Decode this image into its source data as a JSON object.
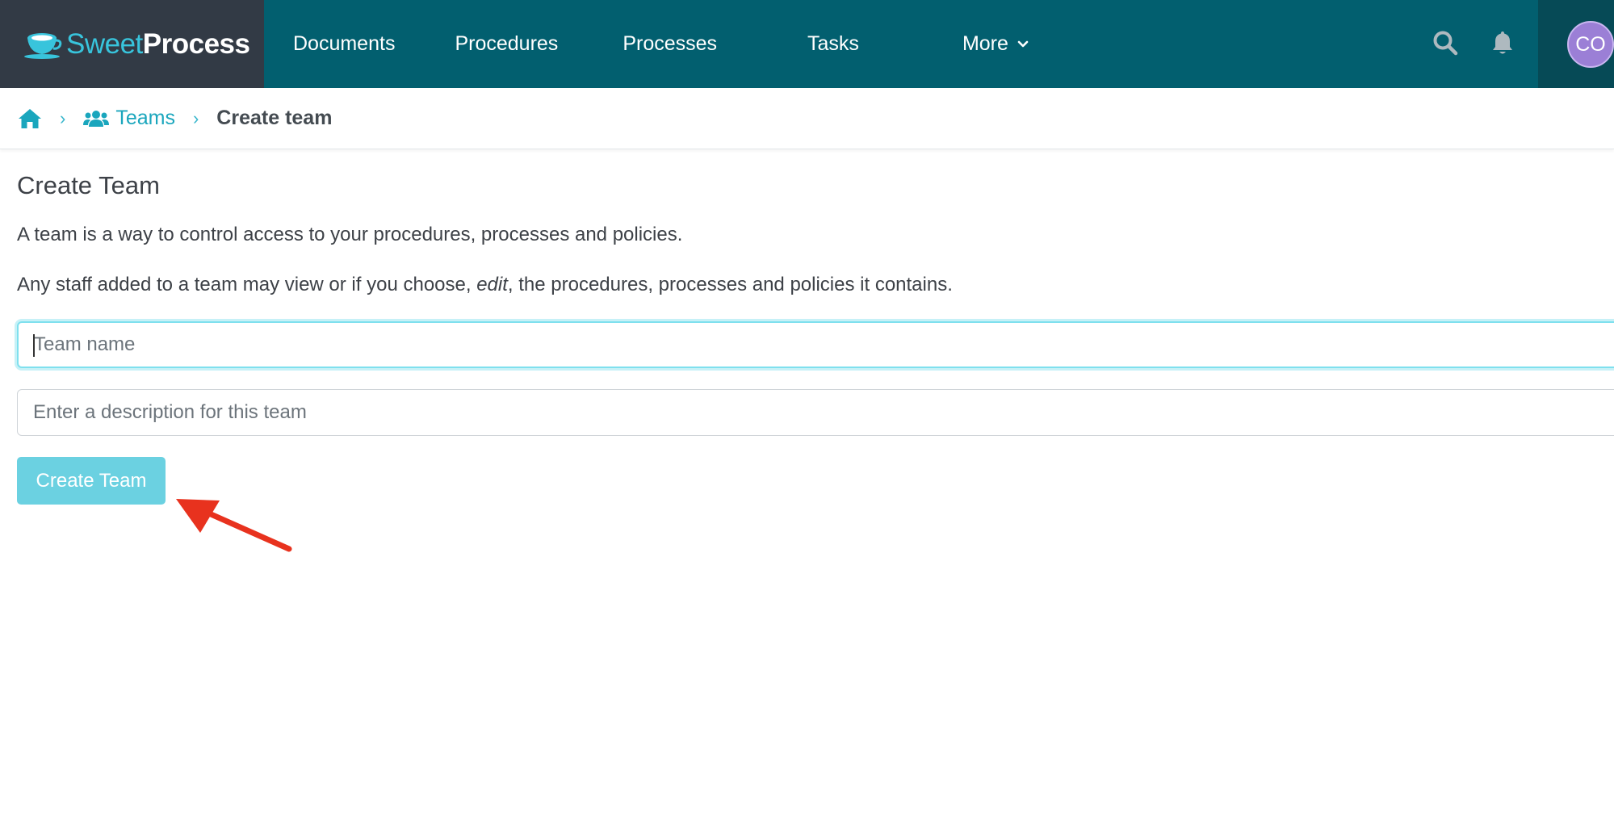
{
  "app": {
    "brand_sweet": "Sweet",
    "brand_process": "Process"
  },
  "nav": {
    "items": [
      {
        "label": "Documents"
      },
      {
        "label": "Procedures"
      },
      {
        "label": "Processes"
      },
      {
        "label": "Tasks"
      },
      {
        "label": "More"
      }
    ],
    "icons": [
      "search-icon",
      "bell-icon",
      "chevron-down-icon"
    ],
    "avatar_initials": "CO"
  },
  "breadcrumb": {
    "teams": "Teams",
    "current": "Create team"
  },
  "main": {
    "title": "Create Team",
    "para1": "A team is a way to control access to your procedures, processes and policies.",
    "para2_before": "Any staff added to a team may view or if you choose, ",
    "para2_em": "edit",
    "para2_after": ", the procedures, processes and policies it contains.",
    "team_name_placeholder": "Team name",
    "team_name_value": "",
    "description_placeholder": "Enter a description for this team",
    "description_value": "",
    "create_button": "Create Team"
  },
  "colors": {
    "nav_bg": "#025f6f",
    "brand_bg": "#323a45",
    "accent": "#1aa6bd",
    "button_bg": "#6bd1e1",
    "arrow": "#e8321e",
    "avatar": "#9b7fd6"
  }
}
